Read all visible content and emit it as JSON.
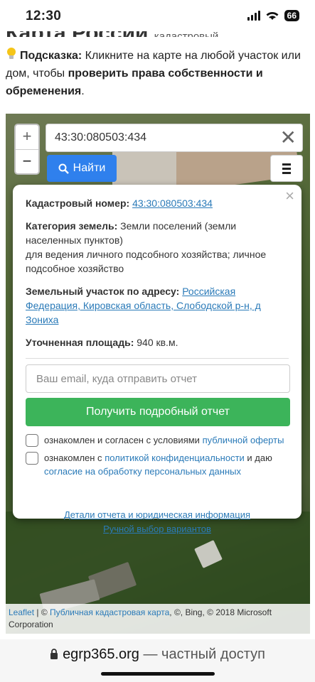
{
  "status": {
    "time": "12:30",
    "battery": "66"
  },
  "page": {
    "cut_title": "Карта России",
    "cut_title_small": "кадастровый",
    "hint_label": "Подсказка:",
    "hint_text": " Кликните на карте на любой участок или дом, чтобы ",
    "hint_bold": "проверить права собственности и обременения",
    "hint_end": "."
  },
  "map": {
    "zoom_in": "+",
    "zoom_out": "−",
    "search_value": "43:30:080503:434",
    "search_clear": "✕",
    "find_label": "Найти"
  },
  "popup": {
    "close": "×",
    "cad_label": "Кадастровый номер:",
    "cad_value": "43:30:080503:434",
    "cat_label": "Категория земель:",
    "cat_value": " Земли поселений (земли населенных пунктов)",
    "cat_use": "для ведения личного подсобного хозяйства; личное подсобное хозяйство",
    "addr_label": "Земельный участок по адресу:",
    "addr_value": "Российская Федерация, Кировская область, Слободской р-н, д Зониха",
    "area_label": "Уточненная площадь:",
    "area_value": " 940 кв.м.",
    "email_placeholder": "Ваш email, куда отправить отчет",
    "get_report": "Получить подробный отчет",
    "check1_text": "ознакомлен и согласен с условиями ",
    "check1_link": "публичной оферты",
    "check2_text": "ознакомлен с ",
    "check2_link": "политикой конфиденциальности",
    "check2_text2": " и даю ",
    "check2_link2": "согласие на обработку персональных данных",
    "details_link": "Детали отчета и юридическая информация",
    "manual_link": "Ручной выбор вариантов"
  },
  "attribution": {
    "leaflet": "Leaflet",
    "sep": " | © ",
    "pkk": "Публичная кадастровая карта",
    "rest": ", ©, Bing, © 2018 Microsoft Corporation"
  },
  "browser": {
    "domain": "egrp365.org",
    "suffix": " — частный доступ"
  }
}
